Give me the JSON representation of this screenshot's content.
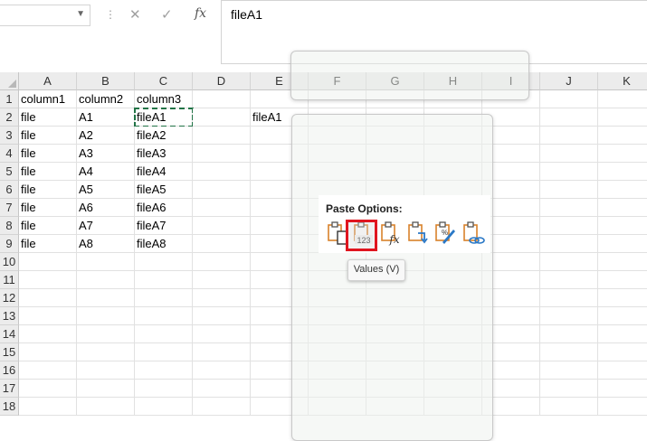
{
  "formula_bar": {
    "name_box": "",
    "cancel_icon": "close-icon",
    "enter_icon": "check-icon",
    "function_label": "fx",
    "content": "fileA1"
  },
  "columns": [
    "A",
    "B",
    "C",
    "D",
    "E",
    "F",
    "G",
    "H",
    "I",
    "J",
    "K"
  ],
  "rows": [
    "1",
    "2",
    "3",
    "4",
    "5",
    "6",
    "7",
    "8",
    "9",
    "10",
    "11",
    "12",
    "13",
    "14",
    "15",
    "16",
    "17",
    "18"
  ],
  "cells": {
    "A1": "column1",
    "B1": "column2",
    "C1": "column3",
    "A2": "file",
    "B2": "A1",
    "C2": "fileA1",
    "E2": "fileA1",
    "A3": "file",
    "B3": "A2",
    "C3": "fileA2",
    "A4": "file",
    "B4": "A3",
    "C4": "fileA3",
    "A5": "file",
    "B5": "A4",
    "C5": "fileA4",
    "A6": "file",
    "B6": "A5",
    "C6": "fileA5",
    "A7": "file",
    "B7": "A6",
    "C7": "fileA6",
    "A8": "file",
    "B8": "A7",
    "C8": "fileA7",
    "A9": "file",
    "B9": "A8",
    "C9": "fileA8"
  },
  "copied_cell": "C2",
  "paste_menu": {
    "title": "Paste Options:",
    "options": [
      {
        "name": "paste-icon"
      },
      {
        "name": "paste-values-icon",
        "sub": "123"
      },
      {
        "name": "paste-formulas-icon",
        "sub": "fx"
      },
      {
        "name": "paste-transpose-icon"
      },
      {
        "name": "paste-formatting-icon"
      },
      {
        "name": "paste-link-icon"
      }
    ],
    "selected_option": "paste-values-icon",
    "tooltip": "Values (V)"
  },
  "colors": {
    "header_bg": "#ececec",
    "gridline": "#e1e1e1",
    "copy_marquee": "#217346",
    "highlight": "#e0151f",
    "clipboard_orange": "#d9822b",
    "icon_blue": "#2a78c6"
  }
}
